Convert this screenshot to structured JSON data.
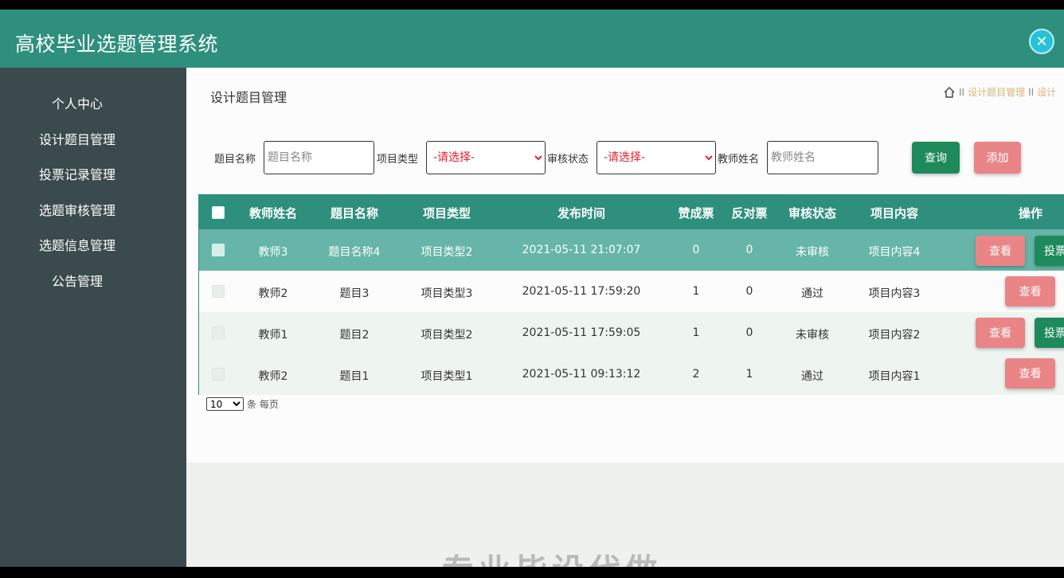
{
  "app": {
    "title": "高校毕业选题管理系统",
    "close_glyph": "✕"
  },
  "sidebar": {
    "items": [
      {
        "label": "个人中心"
      },
      {
        "label": "设计题目管理"
      },
      {
        "label": "投票记录管理"
      },
      {
        "label": "选题审核管理"
      },
      {
        "label": "选题信息管理"
      },
      {
        "label": "公告管理"
      }
    ]
  },
  "page": {
    "title": "设计题目管理"
  },
  "breadcrumb": {
    "separator": "II",
    "items": [
      "设计题目管理",
      "设计"
    ]
  },
  "search": {
    "title_label": "题目名称",
    "title_placeholder": "题目名称",
    "type_label": "项目类型",
    "type_value": "-请选择-",
    "status_label": "审核状态",
    "status_value": "-请选择-",
    "teacher_label": "教师姓名",
    "teacher_placeholder": "教师姓名",
    "query_label": "查询",
    "add_label": "添加"
  },
  "table": {
    "headers": [
      "教师姓名",
      "题目名称",
      "项目类型",
      "发布时间",
      "赞成票",
      "反对票",
      "审核状态",
      "项目内容",
      "操作"
    ],
    "rows": [
      {
        "teacher": "教师3",
        "title": "题目名称4",
        "type": "项目类型2",
        "time": "2021-05-11 21:07:07",
        "yes": "0",
        "no": "0",
        "status": "未审核",
        "content": "项目内容4",
        "view": "查看",
        "vote": "投票"
      },
      {
        "teacher": "教师2",
        "title": "题目3",
        "type": "项目类型3",
        "time": "2021-05-11 17:59:20",
        "yes": "1",
        "no": "0",
        "status": "通过",
        "content": "项目内容3",
        "view": "查看"
      },
      {
        "teacher": "教师1",
        "title": "题目2",
        "type": "项目类型2",
        "time": "2021-05-11 17:59:05",
        "yes": "1",
        "no": "0",
        "status": "未审核",
        "content": "项目内容2",
        "view": "查看",
        "vote": "投票"
      },
      {
        "teacher": "教师2",
        "title": "题目1",
        "type": "项目类型1",
        "time": "2021-05-11 09:13:12",
        "yes": "2",
        "no": "1",
        "status": "通过",
        "content": "项目内容1",
        "view": "查看"
      }
    ]
  },
  "pager": {
    "page_size": "10",
    "suffix": "条 每页"
  },
  "watermark": {
    "text": "专业毕设代做"
  }
}
